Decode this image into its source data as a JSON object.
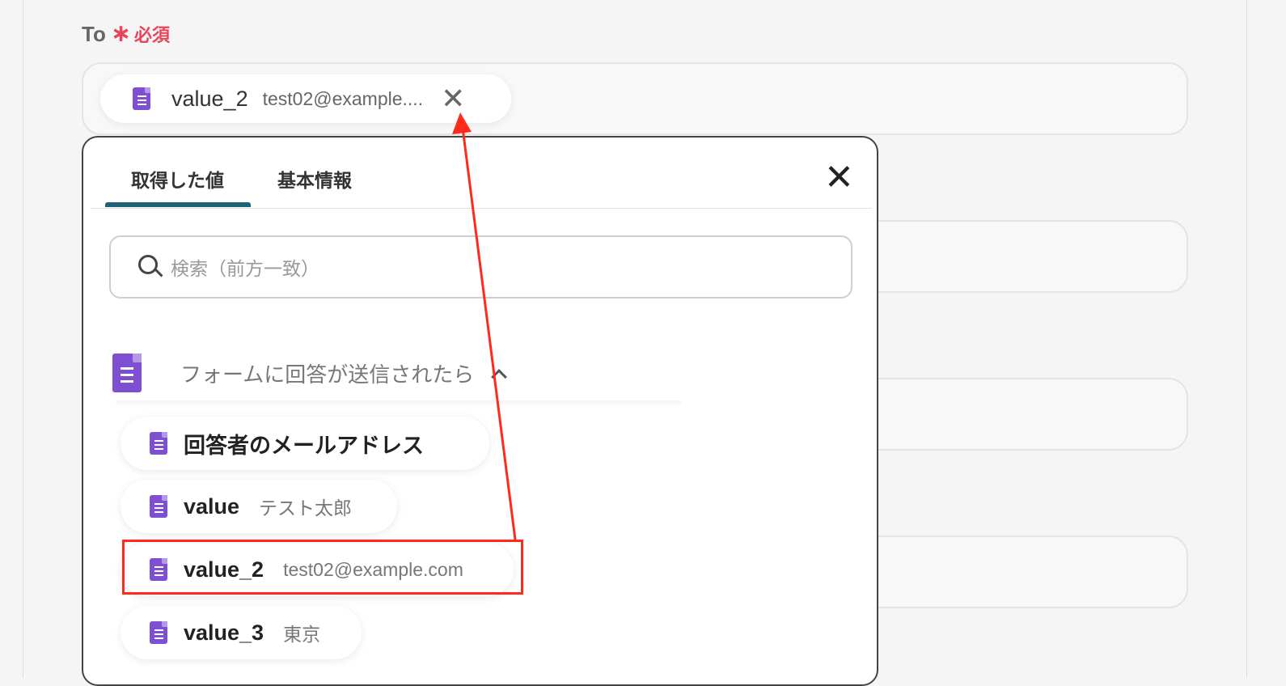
{
  "field": {
    "label": "To",
    "required_mark": "∗",
    "required_text": "必須"
  },
  "selected_chip": {
    "icon": "form-doc-icon",
    "name": "value_2",
    "value": "test02@example....",
    "remove_icon": "close-icon",
    "remove_glyph": "✕"
  },
  "popup": {
    "tabs": [
      {
        "label": "取得した値",
        "active": true
      },
      {
        "label": "基本情報",
        "active": false
      }
    ],
    "close_glyph": "✕",
    "search": {
      "placeholder": "検索（前方一致）"
    },
    "group": {
      "icon": "form-doc-icon",
      "title": "フォームに回答が送信されたら",
      "expanded": true
    },
    "items": [
      {
        "name": "回答者のメールアドレス",
        "value": ""
      },
      {
        "name": "value",
        "value": "テスト太郎"
      },
      {
        "name": "value_2",
        "value": "test02@example.com",
        "highlighted": true
      },
      {
        "name": "value_3",
        "value": "東京"
      }
    ]
  },
  "colors": {
    "accent_tab": "#1d6275",
    "required": "#e8445a",
    "icon_purple": "#7e4fd1",
    "annotation_red": "#ff2a1a"
  }
}
